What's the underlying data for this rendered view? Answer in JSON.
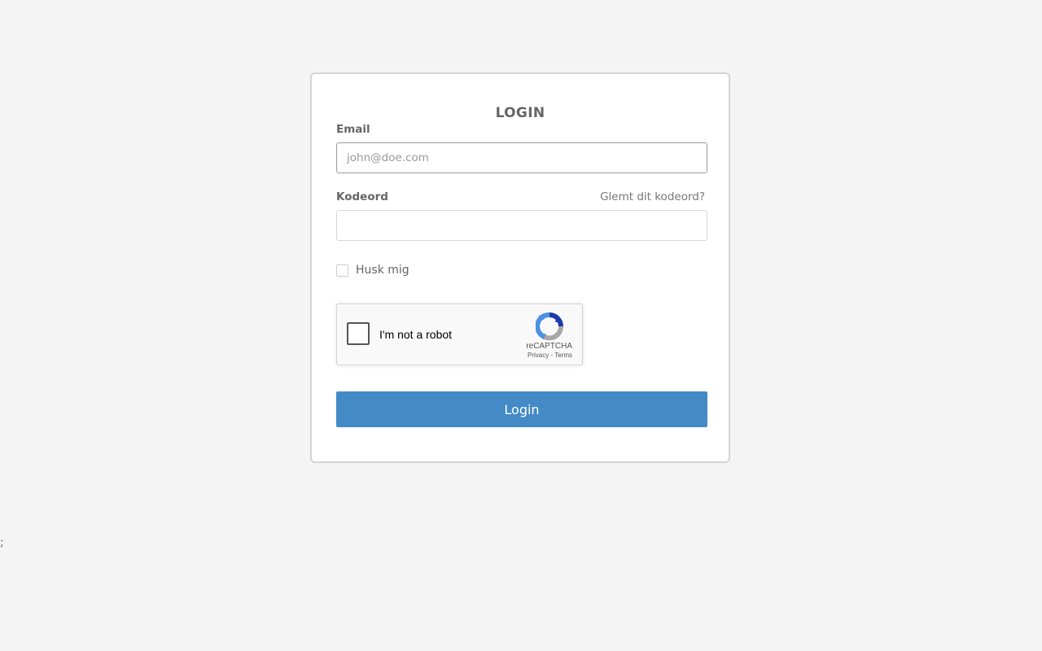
{
  "form": {
    "title": "LOGIN",
    "email_label": "Email",
    "email_placeholder": "john@doe.com",
    "email_value": "",
    "password_label": "Kodeord",
    "password_value": "",
    "forgot_link": "Glemt dit kodeord?",
    "remember_label": "Husk mig",
    "remember_checked": false,
    "submit_label": "Login"
  },
  "captcha": {
    "label": "I'm not a robot",
    "brand": "reCAPTCHA",
    "privacy": "Privacy",
    "separator": " - ",
    "terms": "Terms",
    "checked": false
  },
  "stray_text": ";",
  "colors": {
    "page_bg": "#f4f4f4",
    "button": "#438ac6",
    "text": "#666666"
  },
  "icons": {
    "captcha_logo": "recaptcha-logo-icon"
  }
}
